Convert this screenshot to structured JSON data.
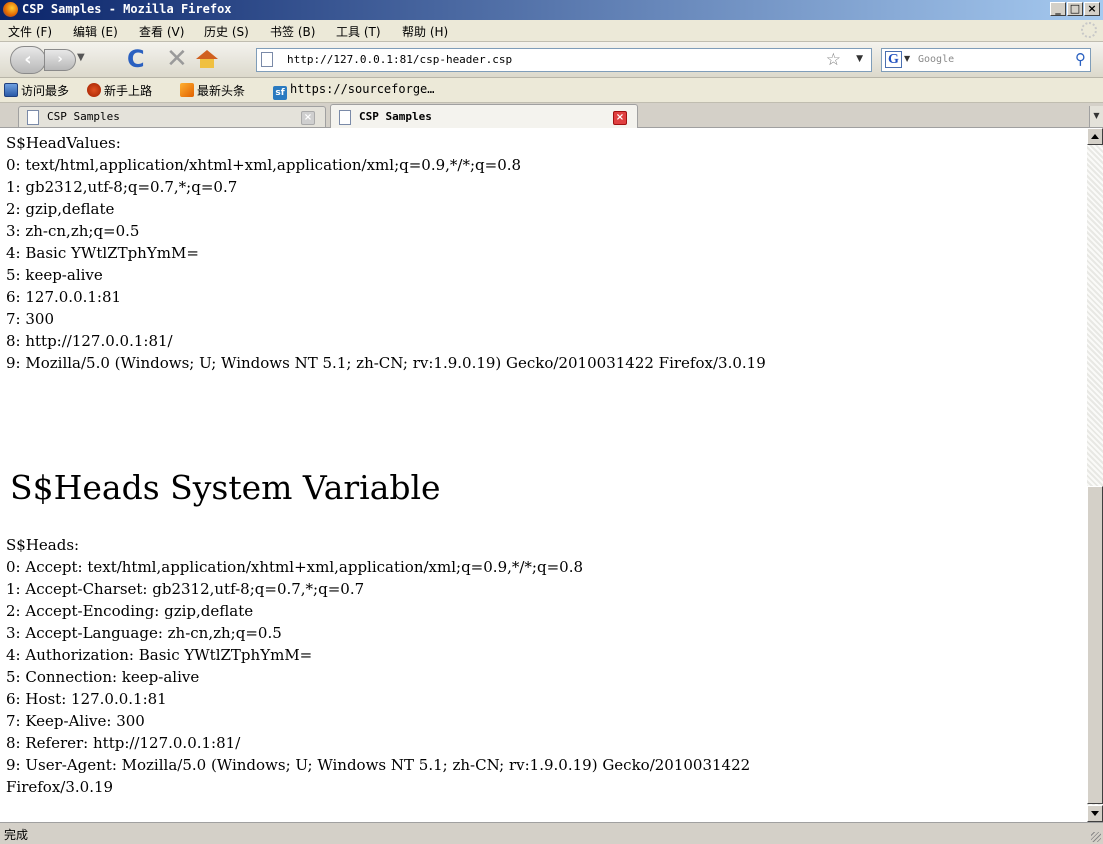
{
  "window": {
    "title": "CSP Samples - Mozilla Firefox"
  },
  "menu": {
    "items": [
      "文件 (F)",
      "编辑 (E)",
      "查看 (V)",
      "历史 (S)",
      "书签 (B)",
      "工具 (T)",
      "帮助 (H)"
    ]
  },
  "navbar": {
    "url": "http://127.0.0.1:81/csp-header.csp",
    "search_placeholder": "Google"
  },
  "bookmarks": {
    "items": [
      "访问最多",
      "新手上路",
      "最新头条",
      "https://sourceforge…"
    ],
    "icons": [
      "most-visited-icon",
      "getting-started-icon",
      "rss-feed-icon",
      "sourceforge-icon"
    ]
  },
  "tabs": [
    {
      "label": "CSP Samples",
      "active": false
    },
    {
      "label": "CSP Samples",
      "active": true
    }
  ],
  "content": {
    "head_values_title": "S$HeadValues:",
    "head_values": [
      "0: text/html,application/xhtml+xml,application/xml;q=0.9,*/*;q=0.8",
      "1: gb2312,utf-8;q=0.7,*;q=0.7",
      "2: gzip,deflate",
      "3: zh-cn,zh;q=0.5",
      "4: Basic YWtlZTphYmM=",
      "5: keep-alive",
      "6: 127.0.0.1:81",
      "7: 300",
      "8: http://127.0.0.1:81/",
      "9: Mozilla/5.0 (Windows; U; Windows NT 5.1; zh-CN; rv:1.9.0.19) Gecko/2010031422 Firefox/3.0.19"
    ],
    "heading": "S$Heads System Variable",
    "heads_title": "S$Heads:",
    "heads": [
      "0: Accept: text/html,application/xhtml+xml,application/xml;q=0.9,*/*;q=0.8",
      "1: Accept-Charset: gb2312,utf-8;q=0.7,*;q=0.7",
      "2: Accept-Encoding: gzip,deflate",
      "3: Accept-Language: zh-cn,zh;q=0.5",
      "4: Authorization: Basic YWtlZTphYmM=",
      "5: Connection: keep-alive",
      "6: Host: 127.0.0.1:81",
      "7: Keep-Alive: 300",
      "8: Referer: http://127.0.0.1:81/",
      "9: User-Agent: Mozilla/5.0 (Windows; U; Windows NT 5.1; zh-CN; rv:1.9.0.19) Gecko/2010031422",
      "Firefox/3.0.19"
    ]
  },
  "status": {
    "text": "完成"
  }
}
